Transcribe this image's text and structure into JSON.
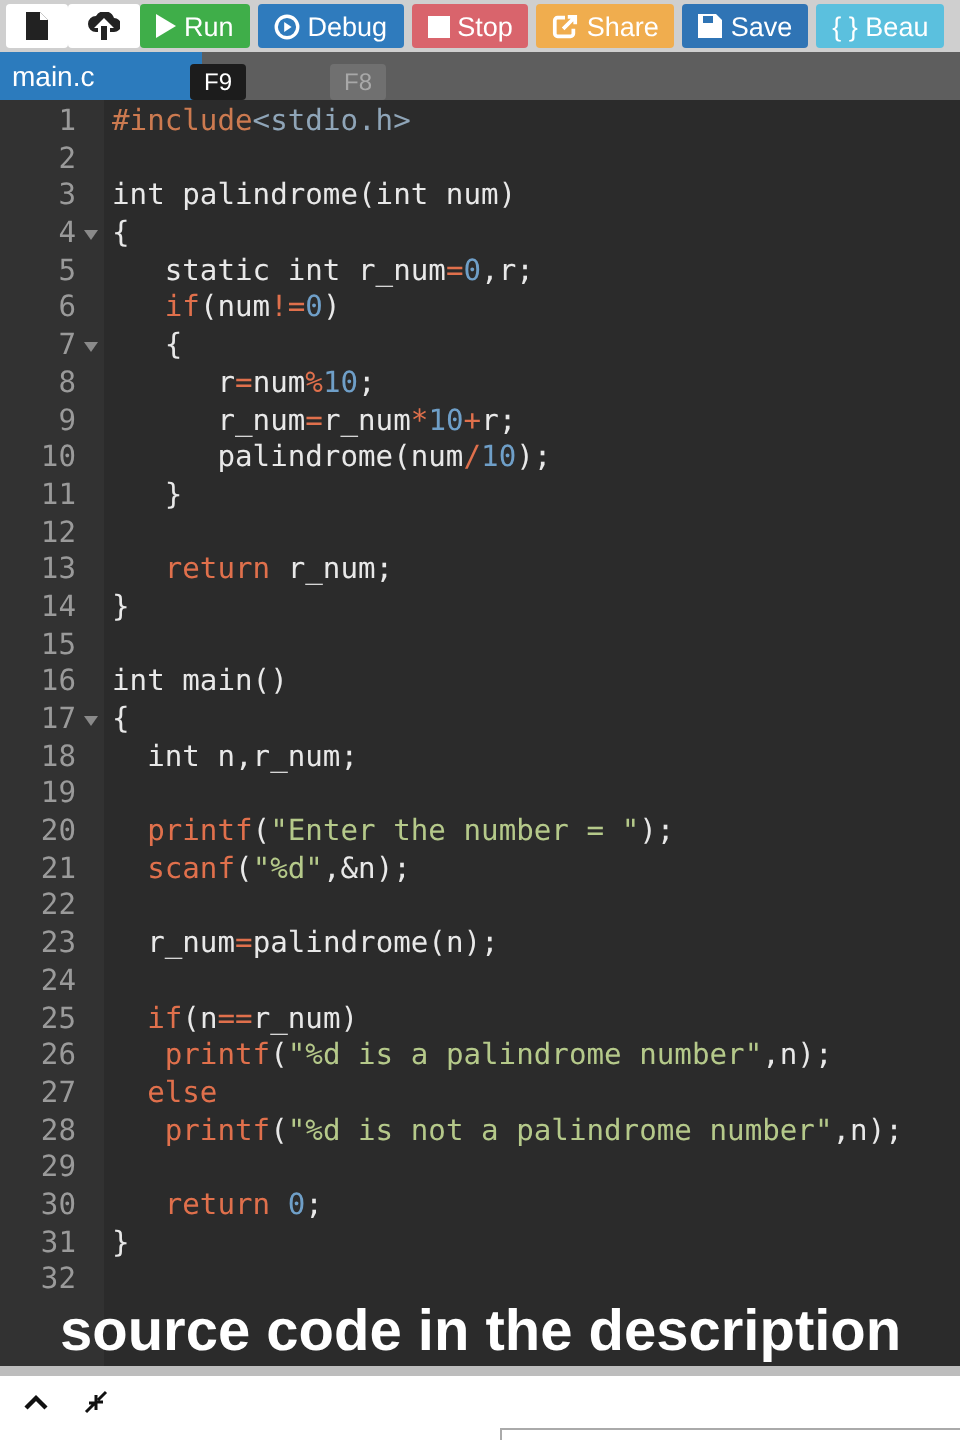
{
  "toolbar": {
    "buttons": [
      {
        "kind": "new-file"
      },
      {
        "kind": "upload"
      },
      {
        "kind": "run",
        "label": "Run"
      },
      {
        "kind": "debug",
        "label": "Debug"
      },
      {
        "kind": "stop",
        "label": "Stop"
      },
      {
        "kind": "share",
        "label": "Share"
      },
      {
        "kind": "save",
        "label": "Save"
      },
      {
        "kind": "beautify",
        "label": "{ } Beau"
      }
    ]
  },
  "tabs": [
    {
      "label": "main.c",
      "selected": true
    }
  ],
  "tooltips": [
    {
      "text": "F9",
      "faded": false
    },
    {
      "text": "F8",
      "faded": true
    }
  ],
  "editor": {
    "lines": [
      {
        "n": "1",
        "fold": false,
        "tokens": [
          {
            "kind": "pre",
            "text": "#include"
          },
          {
            "kind": "header",
            "text": "<stdio.h>"
          }
        ]
      },
      {
        "n": "2",
        "fold": false
      },
      {
        "n": "3",
        "fold": false,
        "tokens": [
          {
            "kind": "plain",
            "text": "int palindrome(int num)"
          }
        ]
      },
      {
        "n": "4",
        "fold": true,
        "tokens": [
          {
            "kind": "plain",
            "text": "{"
          }
        ]
      },
      {
        "n": "5",
        "fold": false,
        "tokens": [
          {
            "kind": "plain",
            "text": "   static int r_num"
          },
          {
            "kind": "op",
            "text": "="
          },
          {
            "kind": "num",
            "text": "0"
          },
          {
            "kind": "plain",
            "text": ",r;"
          }
        ]
      },
      {
        "n": "6",
        "fold": false,
        "tokens": [
          {
            "kind": "kw",
            "text": "   if"
          },
          {
            "kind": "plain",
            "text": "(num"
          },
          {
            "kind": "op",
            "text": "!="
          },
          {
            "kind": "num",
            "text": "0"
          },
          {
            "kind": "plain",
            "text": ")"
          }
        ]
      },
      {
        "n": "7",
        "fold": true,
        "tokens": [
          {
            "kind": "plain",
            "text": "   {"
          }
        ]
      },
      {
        "n": "8",
        "fold": false,
        "tokens": [
          {
            "kind": "plain",
            "text": "      r"
          },
          {
            "kind": "op",
            "text": "="
          },
          {
            "kind": "plain",
            "text": "num"
          },
          {
            "kind": "op",
            "text": "%"
          },
          {
            "kind": "num",
            "text": "10"
          },
          {
            "kind": "plain",
            "text": ";"
          }
        ]
      },
      {
        "n": "9",
        "fold": false,
        "tokens": [
          {
            "kind": "plain",
            "text": "      r_num"
          },
          {
            "kind": "op",
            "text": "="
          },
          {
            "kind": "plain",
            "text": "r_num"
          },
          {
            "kind": "op",
            "text": "*"
          },
          {
            "kind": "num",
            "text": "10"
          },
          {
            "kind": "op",
            "text": "+"
          },
          {
            "kind": "plain",
            "text": "r;"
          }
        ]
      },
      {
        "n": "10",
        "fold": false,
        "tokens": [
          {
            "kind": "plain",
            "text": "      palindrome(num"
          },
          {
            "kind": "op",
            "text": "/"
          },
          {
            "kind": "num",
            "text": "10"
          },
          {
            "kind": "plain",
            "text": ");"
          }
        ]
      },
      {
        "n": "11",
        "fold": false,
        "tokens": [
          {
            "kind": "plain",
            "text": "   }"
          }
        ]
      },
      {
        "n": "12",
        "fold": false
      },
      {
        "n": "13",
        "fold": false,
        "tokens": [
          {
            "kind": "kw",
            "text": "   return"
          },
          {
            "kind": "plain",
            "text": " r_num;"
          }
        ]
      },
      {
        "n": "14",
        "fold": false,
        "tokens": [
          {
            "kind": "plain",
            "text": "}"
          }
        ]
      },
      {
        "n": "15",
        "fold": false
      },
      {
        "n": "16",
        "fold": false,
        "tokens": [
          {
            "kind": "plain",
            "text": "int main()"
          }
        ]
      },
      {
        "n": "17",
        "fold": true,
        "tokens": [
          {
            "kind": "plain",
            "text": "{"
          }
        ]
      },
      {
        "n": "18",
        "fold": false,
        "tokens": [
          {
            "kind": "plain",
            "text": "  int n,r_num;"
          }
        ]
      },
      {
        "n": "19",
        "fold": false
      },
      {
        "n": "20",
        "fold": false,
        "tokens": [
          {
            "kind": "kw",
            "text": "  printf"
          },
          {
            "kind": "plain",
            "text": "("
          },
          {
            "kind": "str",
            "text": "\"Enter the number = \""
          },
          {
            "kind": "plain",
            "text": ");"
          }
        ]
      },
      {
        "n": "21",
        "fold": false,
        "tokens": [
          {
            "kind": "kw",
            "text": "  scanf"
          },
          {
            "kind": "plain",
            "text": "("
          },
          {
            "kind": "str",
            "text": "\"%d\""
          },
          {
            "kind": "plain",
            "text": ",&n);"
          }
        ]
      },
      {
        "n": "22",
        "fold": false
      },
      {
        "n": "23",
        "fold": false,
        "tokens": [
          {
            "kind": "plain",
            "text": "  r_num"
          },
          {
            "kind": "op",
            "text": "="
          },
          {
            "kind": "plain",
            "text": "palindrome(n);"
          }
        ]
      },
      {
        "n": "24",
        "fold": false
      },
      {
        "n": "25",
        "fold": false,
        "tokens": [
          {
            "kind": "kw",
            "text": "  if"
          },
          {
            "kind": "plain",
            "text": "(n"
          },
          {
            "kind": "op",
            "text": "=="
          },
          {
            "kind": "plain",
            "text": "r_num)"
          }
        ]
      },
      {
        "n": "26",
        "fold": false,
        "tokens": [
          {
            "kind": "kw",
            "text": "   printf"
          },
          {
            "kind": "plain",
            "text": "("
          },
          {
            "kind": "str",
            "text": "\"%d is a palindrome number\""
          },
          {
            "kind": "plain",
            "text": ",n);"
          }
        ]
      },
      {
        "n": "27",
        "fold": false,
        "tokens": [
          {
            "kind": "kw",
            "text": "  else"
          }
        ]
      },
      {
        "n": "28",
        "fold": false,
        "tokens": [
          {
            "kind": "kw",
            "text": "   printf"
          },
          {
            "kind": "plain",
            "text": "("
          },
          {
            "kind": "str",
            "text": "\"%d is not a palindrome number\""
          },
          {
            "kind": "plain",
            "text": ",n);"
          }
        ]
      },
      {
        "n": "29",
        "fold": false
      },
      {
        "n": "30",
        "fold": false,
        "tokens": [
          {
            "kind": "kw",
            "text": "   return "
          },
          {
            "kind": "num",
            "text": "0"
          },
          {
            "kind": "plain",
            "text": ";"
          }
        ]
      },
      {
        "n": "31",
        "fold": false,
        "tokens": [
          {
            "kind": "plain",
            "text": "}"
          }
        ]
      },
      {
        "n": "32",
        "fold": false
      }
    ]
  },
  "caption": "source code in the description"
}
